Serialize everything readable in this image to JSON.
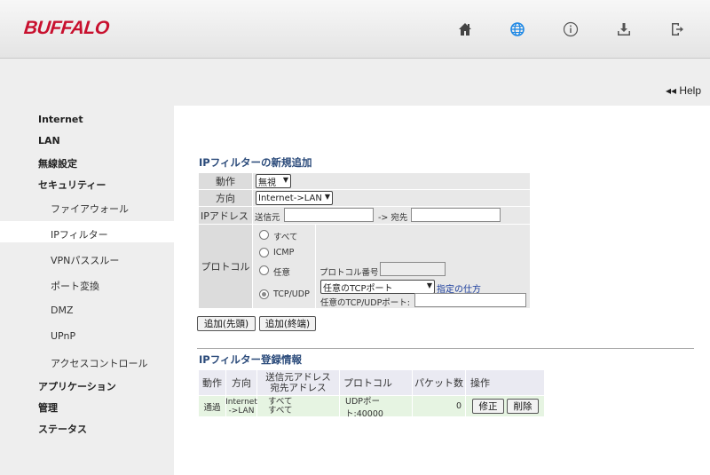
{
  "header": {
    "logo": "BUFFALO",
    "icons": [
      "home-icon",
      "globe-icon",
      "info-icon",
      "download-icon",
      "logout-icon"
    ]
  },
  "help": {
    "label": "◂◂ Help"
  },
  "sidebar": {
    "items": [
      {
        "label": "Internet",
        "level": 0
      },
      {
        "label": "LAN",
        "level": 0
      },
      {
        "label": "無線設定",
        "level": 0
      },
      {
        "label": "セキュリティー",
        "level": 0
      },
      {
        "label": "ファイアウォール",
        "level": 1
      },
      {
        "label": "IPフィルター",
        "level": 1,
        "active": true
      },
      {
        "label": "VPNパススルー",
        "level": 1
      },
      {
        "label": "ポート変換",
        "level": 1
      },
      {
        "label": "DMZ",
        "level": 1
      },
      {
        "label": "UPnP",
        "level": 1
      },
      {
        "label": "アクセスコントロール",
        "level": 1
      },
      {
        "label": "アプリケーション",
        "level": 0
      },
      {
        "label": "管理",
        "level": 0
      },
      {
        "label": "ステータス",
        "level": 0
      }
    ]
  },
  "add_form": {
    "title": "IPフィルターの新規追加",
    "action_label": "動作",
    "action_value": "無視",
    "direction_label": "方向",
    "direction_value": "Internet->LAN",
    "ip_label": "IPアドレス",
    "src_label": "送信元",
    "dst_label": "-> 宛先",
    "protocol_label": "プロトコル",
    "protocols": [
      "すべて",
      "ICMP",
      "任意",
      "TCP/UDP"
    ],
    "selected_protocol": "TCP/UDP",
    "protocol_number_label": "プロトコル番号",
    "tcp_port_select": "任意のTCPポート",
    "spec_link": "指定の仕方",
    "any_port_label": "任意のTCP/UDPポート:",
    "add_first": "追加(先頭)",
    "add_last": "追加(終端)"
  },
  "list": {
    "title": "IPフィルター登録情報",
    "headers": {
      "action": "動作",
      "direction": "方向",
      "addr_src": "送信元アドレス",
      "addr_dst": "宛先アドレス",
      "protocol": "プロトコル",
      "packets": "パケット数",
      "ops": "操作"
    },
    "rows": [
      {
        "action": "通過",
        "direction_1": "Internet",
        "direction_2": "->LAN",
        "src": "すべて",
        "dst": "すべて",
        "protocol": "UDPポート:40000",
        "packets": "0",
        "edit": "修正",
        "delete": "削除"
      }
    ]
  }
}
